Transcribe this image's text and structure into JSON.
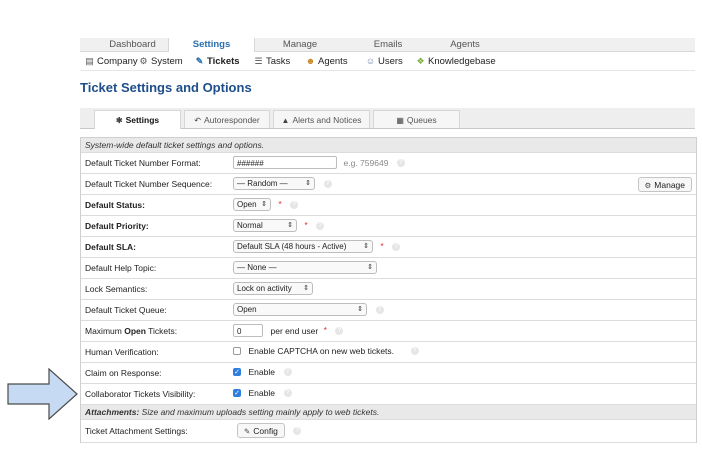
{
  "topnav": [
    {
      "label": "Dashboard",
      "active": false
    },
    {
      "label": "Settings",
      "active": true
    },
    {
      "label": "Manage",
      "active": false
    },
    {
      "label": "Emails",
      "active": false
    },
    {
      "label": "Agents",
      "active": false
    }
  ],
  "subnav": {
    "company": "Company",
    "system": "System",
    "tickets": "Tickets",
    "tasks": "Tasks",
    "agents": "Agents",
    "users": "Users",
    "knowledgebase": "Knowledgebase"
  },
  "page_title": "Ticket Settings and Options",
  "tabs": {
    "settings": "Settings",
    "autoresponder": "Autoresponder",
    "alerts": "Alerts and Notices",
    "queues": "Queues"
  },
  "section_header": "System-wide default ticket settings and options.",
  "fields": {
    "number_format": {
      "label": "Default Ticket Number Format:",
      "value": "######",
      "example": "e.g. 759649"
    },
    "number_sequence": {
      "label": "Default Ticket Number Sequence:",
      "value": "— Random —",
      "manage": "Manage"
    },
    "status": {
      "label": "Default Status:",
      "value": "Open"
    },
    "priority": {
      "label": "Default Priority:",
      "value": "Normal"
    },
    "sla": {
      "label": "Default SLA:",
      "value": "Default SLA (48 hours - Active)"
    },
    "help_topic": {
      "label": "Default Help Topic:",
      "value": "— None —"
    },
    "lock": {
      "label": "Lock Semantics:",
      "value": "Lock on activity"
    },
    "queue": {
      "label": "Default Ticket Queue:",
      "value": "Open"
    },
    "max_open": {
      "label_pre": "Maximum ",
      "label_bold": "Open",
      "label_post": " Tickets:",
      "value": "0",
      "suffix": "per end user"
    },
    "captcha": {
      "label": "Human Verification:",
      "checked": false,
      "text": "Enable CAPTCHA on new web tickets."
    },
    "claim": {
      "label": "Claim on Response:",
      "checked": true,
      "text": "Enable"
    },
    "collab": {
      "label": "Collaborator Tickets Visibility:",
      "checked": true,
      "text": "Enable"
    }
  },
  "attachments_header": {
    "bold": "Attachments:",
    "rest": " Size and maximum uploads setting mainly apply to web tickets."
  },
  "attachment_settings": {
    "label": "Ticket Attachment Settings:",
    "button": "Config"
  },
  "required_mark": "*",
  "colors": {
    "accent": "#2a6fb0",
    "title": "#1e4f8a",
    "checkbox": "#2f7ee0",
    "arrow_fill": "#c6dbf3",
    "arrow_stroke": "#4a4a4a"
  }
}
